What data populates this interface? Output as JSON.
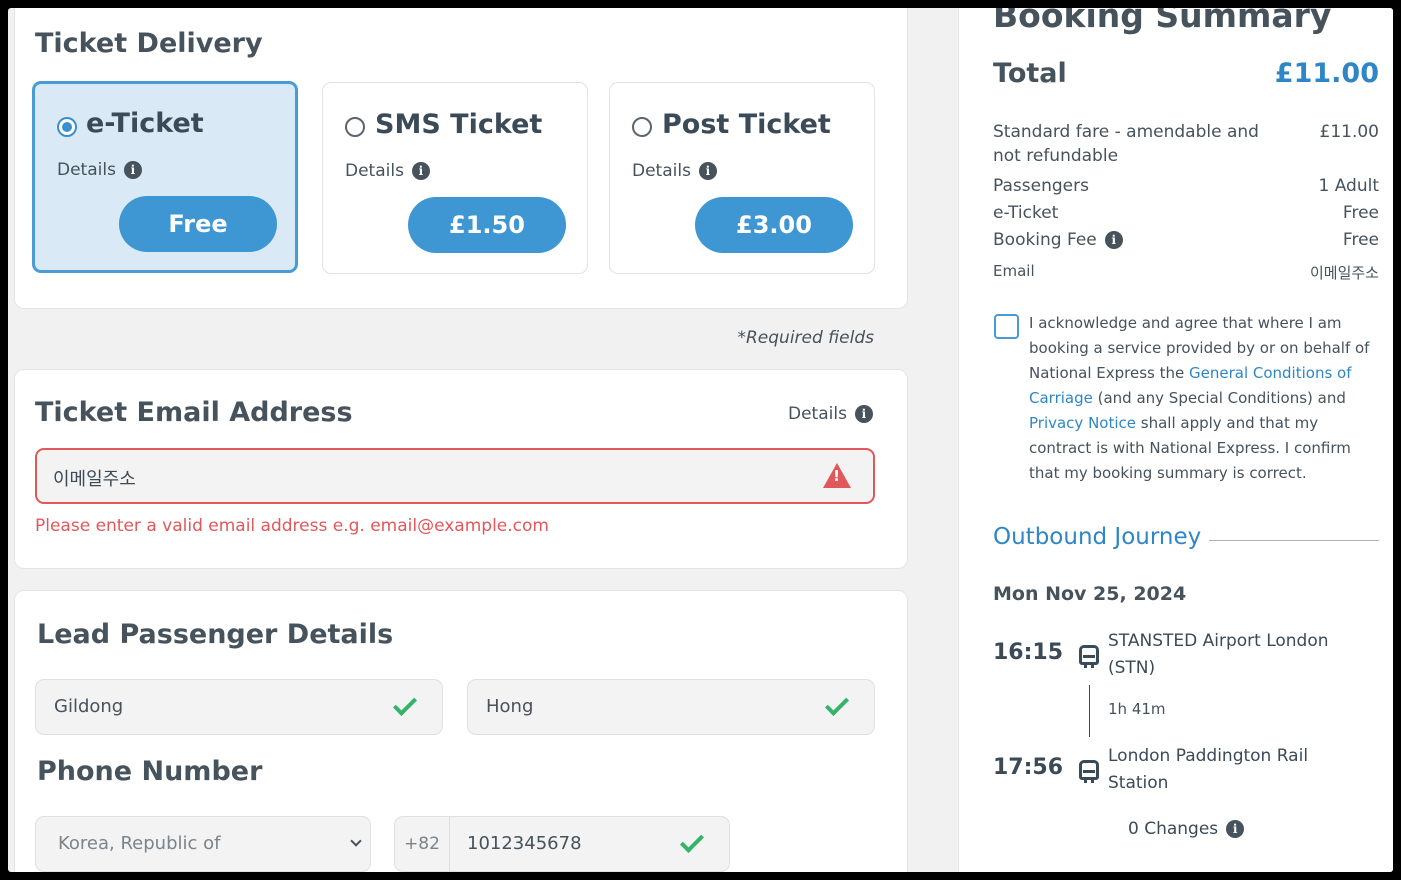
{
  "delivery": {
    "title": "Ticket Delivery",
    "options": [
      {
        "label": "e-Ticket",
        "details": "Details",
        "price": "Free",
        "selected": true
      },
      {
        "label": "SMS Ticket",
        "details": "Details",
        "price": "£1.50",
        "selected": false
      },
      {
        "label": "Post Ticket",
        "details": "Details",
        "price": "£3.00",
        "selected": false
      }
    ]
  },
  "required_note": "*Required fields",
  "email_section": {
    "title": "Ticket Email Address",
    "details": "Details",
    "value": "이메일주소",
    "error": "Please enter a valid email address e.g. email@example.com"
  },
  "passenger": {
    "title": "Lead Passenger Details",
    "first_name": "Gildong",
    "last_name": "Hong"
  },
  "phone": {
    "title": "Phone Number",
    "country": "Korea, Republic of",
    "code": "+82",
    "number": "1012345678"
  },
  "summary": {
    "title": "Booking Summary",
    "total_label": "Total",
    "total_value": "£11.00",
    "fare_label_1": "Standard fare - amendable and",
    "fare_label_2": "not refundable",
    "fare_value": "£11.00",
    "passengers_label": "Passengers",
    "passengers_value": "1 Adult",
    "eticket_label": "e-Ticket",
    "eticket_value": "Free",
    "fee_label": "Booking Fee",
    "fee_value": "Free",
    "email_label": "Email",
    "email_value": "이메일주소"
  },
  "terms": {
    "p1": "I acknowledge and agree that where I am booking a service provided by or on behalf of National Express the ",
    "link1": "General Conditions of Carriage",
    "p2": " (and any Special Conditions) and ",
    "link2": "Privacy Notice",
    "p3": " shall apply and that my contract is with National Express. I confirm that my booking summary is correct."
  },
  "journey": {
    "title": "Outbound Journey",
    "date": "Mon Nov 25, 2024",
    "depart_time": "16:15",
    "depart_station": "STANSTED Airport London (STN)",
    "duration": "1h 41m",
    "arrive_time": "17:56",
    "arrive_station": "London Paddington Rail Station",
    "changes": "0 Changes"
  },
  "colors": {
    "accent": "#3e97d3",
    "error": "#e0585a",
    "success": "#35b36b",
    "link": "#2f86c6"
  }
}
